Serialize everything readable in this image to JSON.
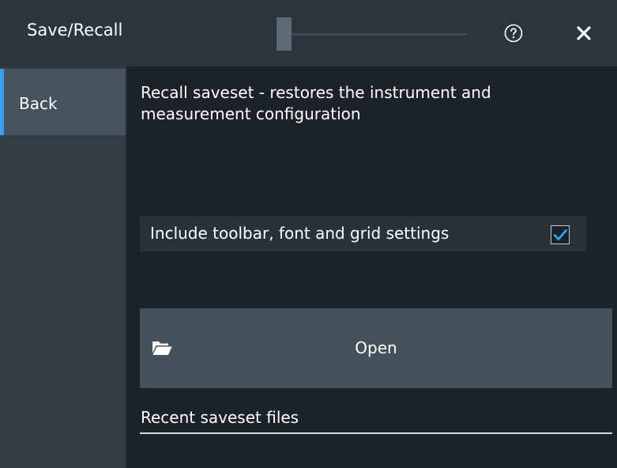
{
  "window": {
    "title": "Save/Recall",
    "help_icon": "help-circle-icon",
    "close_icon": "close-icon"
  },
  "sidebar": {
    "items": [
      {
        "label": "Back",
        "selected": true
      }
    ]
  },
  "main": {
    "description": "Recall saveset - restores the instrument and measurement configuration",
    "include_settings": {
      "label": "Include toolbar, font and grid settings",
      "checked": true
    },
    "open_button": {
      "label": "Open",
      "icon": "folder-open-icon"
    },
    "recent_files_label": "Recent saveset files"
  },
  "colors": {
    "accent": "#3f9df1",
    "background": "#1b2329",
    "titlebar": "#2b353d"
  }
}
